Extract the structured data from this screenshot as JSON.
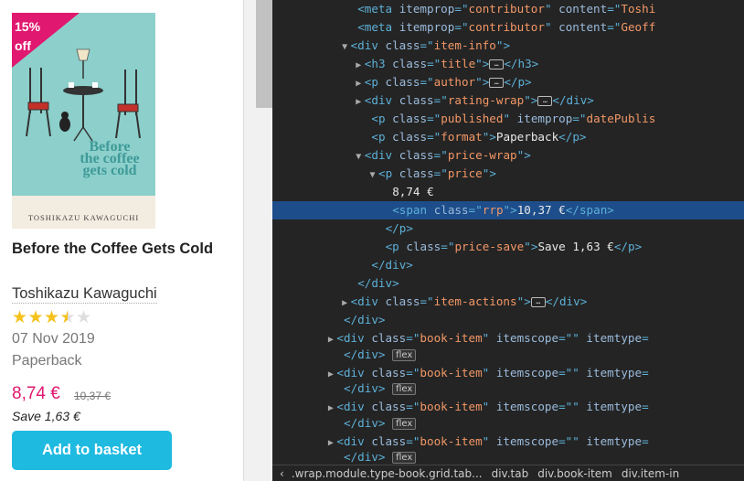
{
  "product": {
    "badge": [
      "15%",
      "off"
    ],
    "cover_title": "Before the coffee gets cold",
    "cover_author": "TOSHIKAZU KAWAGUCHI",
    "title": "Before the Coffee Gets Cold",
    "author": "Toshikazu Kawaguchi",
    "rating": 3.5,
    "rating_max": 5,
    "published": "07 Nov 2019",
    "format": "Paperback",
    "price": "8,74 €",
    "rrp": "10,37 €",
    "save": "Save 1,63 €",
    "button_label": "Add to basket",
    "colors": {
      "accent": "#e0186f",
      "button": "#1ebae0",
      "star": "#f5c21b",
      "cover_bg": "#8ccfcb"
    }
  },
  "devtools": {
    "lines": [
      {
        "indent": 12,
        "twisty": "",
        "parts": [
          [
            "tg",
            "<meta "
          ],
          [
            "an",
            "itemprop"
          ],
          [
            "tg",
            "=\""
          ],
          [
            "av",
            "contributor"
          ],
          [
            "tg",
            "\" "
          ],
          [
            "an",
            "content"
          ],
          [
            "tg",
            "=\""
          ],
          [
            "av",
            "Toshi"
          ]
        ]
      },
      {
        "indent": 12,
        "twisty": "",
        "parts": [
          [
            "tg",
            "<meta "
          ],
          [
            "an",
            "itemprop"
          ],
          [
            "tg",
            "=\""
          ],
          [
            "av",
            "contributor"
          ],
          [
            "tg",
            "\" "
          ],
          [
            "an",
            "content"
          ],
          [
            "tg",
            "=\""
          ],
          [
            "av",
            "Geoff"
          ]
        ]
      },
      {
        "indent": 11,
        "twisty": "▼",
        "parts": [
          [
            "tg",
            "<div "
          ],
          [
            "an",
            "class"
          ],
          [
            "tg",
            "=\""
          ],
          [
            "av",
            "item-info"
          ],
          [
            "tg",
            "\">"
          ]
        ]
      },
      {
        "indent": 13,
        "twisty": "▶",
        "parts": [
          [
            "tg",
            "<h3 "
          ],
          [
            "an",
            "class"
          ],
          [
            "tg",
            "=\""
          ],
          [
            "av",
            "title"
          ],
          [
            "tg",
            "\">"
          ],
          [
            "ell",
            "…"
          ],
          [
            "tg",
            "</h3>"
          ]
        ]
      },
      {
        "indent": 13,
        "twisty": "▶",
        "parts": [
          [
            "tg",
            "<p "
          ],
          [
            "an",
            "class"
          ],
          [
            "tg",
            "=\""
          ],
          [
            "av",
            "author"
          ],
          [
            "tg",
            "\">"
          ],
          [
            "ell",
            "…"
          ],
          [
            "tg",
            "</p>"
          ]
        ]
      },
      {
        "indent": 13,
        "twisty": "▶",
        "parts": [
          [
            "tg",
            "<div "
          ],
          [
            "an",
            "class"
          ],
          [
            "tg",
            "=\""
          ],
          [
            "av",
            "rating-wrap"
          ],
          [
            "tg",
            "\">"
          ],
          [
            "ell",
            "…"
          ],
          [
            "tg",
            "</div>"
          ]
        ]
      },
      {
        "indent": 14,
        "twisty": "",
        "parts": [
          [
            "tg",
            "<p "
          ],
          [
            "an",
            "class"
          ],
          [
            "tg",
            "=\""
          ],
          [
            "av",
            "published"
          ],
          [
            "tg",
            "\" "
          ],
          [
            "an",
            "itemprop"
          ],
          [
            "tg",
            "=\""
          ],
          [
            "av",
            "datePublis"
          ]
        ]
      },
      {
        "indent": 14,
        "twisty": "",
        "parts": [
          [
            "tg",
            "<p "
          ],
          [
            "an",
            "class"
          ],
          [
            "tg",
            "=\""
          ],
          [
            "av",
            "format"
          ],
          [
            "tg",
            "\">"
          ],
          [
            "tx",
            "Paperback"
          ],
          [
            "tg",
            "</p>"
          ]
        ]
      },
      {
        "indent": 13,
        "twisty": "▼",
        "parts": [
          [
            "tg",
            "<div "
          ],
          [
            "an",
            "class"
          ],
          [
            "tg",
            "=\""
          ],
          [
            "av",
            "price-wrap"
          ],
          [
            "tg",
            "\">"
          ]
        ]
      },
      {
        "indent": 15,
        "twisty": "▼",
        "parts": [
          [
            "tg",
            "<p "
          ],
          [
            "an",
            "class"
          ],
          [
            "tg",
            "=\""
          ],
          [
            "av",
            "price"
          ],
          [
            "tg",
            "\">"
          ]
        ]
      },
      {
        "indent": 17,
        "twisty": "",
        "parts": [
          [
            "tx",
            "8,74 €"
          ]
        ]
      },
      {
        "indent": 17,
        "twisty": "",
        "sel": true,
        "parts": [
          [
            "tg",
            "<span "
          ],
          [
            "an",
            "class"
          ],
          [
            "tg",
            "=\""
          ],
          [
            "av",
            "rrp"
          ],
          [
            "tg",
            "\">"
          ],
          [
            "tx",
            "10,37 €"
          ],
          [
            "tg",
            "</span>"
          ]
        ]
      },
      {
        "indent": 16,
        "twisty": "",
        "parts": [
          [
            "tg",
            "</p>"
          ]
        ]
      },
      {
        "indent": 16,
        "twisty": "",
        "parts": [
          [
            "tg",
            "<p "
          ],
          [
            "an",
            "class"
          ],
          [
            "tg",
            "=\""
          ],
          [
            "av",
            "price-save"
          ],
          [
            "tg",
            "\">"
          ],
          [
            "tx",
            "Save 1,63 €"
          ],
          [
            "tg",
            "</p>"
          ]
        ]
      },
      {
        "indent": 14,
        "twisty": "",
        "parts": [
          [
            "tg",
            "</div>"
          ]
        ]
      },
      {
        "indent": 12,
        "twisty": "",
        "parts": [
          [
            "tg",
            "</div>"
          ]
        ]
      },
      {
        "indent": 11,
        "twisty": "▶",
        "parts": [
          [
            "tg",
            "<div "
          ],
          [
            "an",
            "class"
          ],
          [
            "tg",
            "=\""
          ],
          [
            "av",
            "item-actions"
          ],
          [
            "tg",
            "\">"
          ],
          [
            "ell",
            "…"
          ],
          [
            "tg",
            "</div>"
          ]
        ]
      },
      {
        "indent": 10,
        "twisty": "",
        "parts": [
          [
            "tg",
            "</div>"
          ]
        ]
      },
      {
        "indent": 9,
        "twisty": "▶",
        "parts": [
          [
            "tg",
            "<div "
          ],
          [
            "an",
            "class"
          ],
          [
            "tg",
            "=\""
          ],
          [
            "av",
            "book-item"
          ],
          [
            "tg",
            "\" "
          ],
          [
            "an",
            "itemscope"
          ],
          [
            "tg",
            "=\""
          ],
          [
            "av",
            ""
          ],
          [
            "tg",
            "\" "
          ],
          [
            "an",
            "itemtype"
          ],
          [
            "tg",
            "="
          ]
        ]
      },
      {
        "indent": 10,
        "twisty": "",
        "parts": [
          [
            "tg",
            "</div> "
          ],
          [
            "flex",
            "flex"
          ]
        ]
      },
      {
        "indent": 9,
        "twisty": "▶",
        "parts": [
          [
            "tg",
            "<div "
          ],
          [
            "an",
            "class"
          ],
          [
            "tg",
            "=\""
          ],
          [
            "av",
            "book-item"
          ],
          [
            "tg",
            "\" "
          ],
          [
            "an",
            "itemscope"
          ],
          [
            "tg",
            "=\""
          ],
          [
            "av",
            ""
          ],
          [
            "tg",
            "\" "
          ],
          [
            "an",
            "itemtype"
          ],
          [
            "tg",
            "="
          ]
        ]
      },
      {
        "indent": 10,
        "twisty": "",
        "parts": [
          [
            "tg",
            "</div> "
          ],
          [
            "flex",
            "flex"
          ]
        ]
      },
      {
        "indent": 9,
        "twisty": "▶",
        "parts": [
          [
            "tg",
            "<div "
          ],
          [
            "an",
            "class"
          ],
          [
            "tg",
            "=\""
          ],
          [
            "av",
            "book-item"
          ],
          [
            "tg",
            "\" "
          ],
          [
            "an",
            "itemscope"
          ],
          [
            "tg",
            "=\""
          ],
          [
            "av",
            ""
          ],
          [
            "tg",
            "\" "
          ],
          [
            "an",
            "itemtype"
          ],
          [
            "tg",
            "="
          ]
        ]
      },
      {
        "indent": 10,
        "twisty": "",
        "parts": [
          [
            "tg",
            "</div> "
          ],
          [
            "flex",
            "flex"
          ]
        ]
      },
      {
        "indent": 9,
        "twisty": "▶",
        "parts": [
          [
            "tg",
            "<div "
          ],
          [
            "an",
            "class"
          ],
          [
            "tg",
            "=\""
          ],
          [
            "av",
            "book-item"
          ],
          [
            "tg",
            "\" "
          ],
          [
            "an",
            "itemscope"
          ],
          [
            "tg",
            "=\""
          ],
          [
            "av",
            ""
          ],
          [
            "tg",
            "\" "
          ],
          [
            "an",
            "itemtype"
          ],
          [
            "tg",
            "="
          ]
        ]
      },
      {
        "indent": 10,
        "twisty": "",
        "parts": [
          [
            "tg",
            "</div> "
          ],
          [
            "flex",
            "flex"
          ]
        ]
      }
    ],
    "breadcrumbs": [
      "‹",
      ".wrap.module.type-book.grid.tab...",
      "div.tab",
      "div.book-item",
      "div.item-in"
    ]
  }
}
